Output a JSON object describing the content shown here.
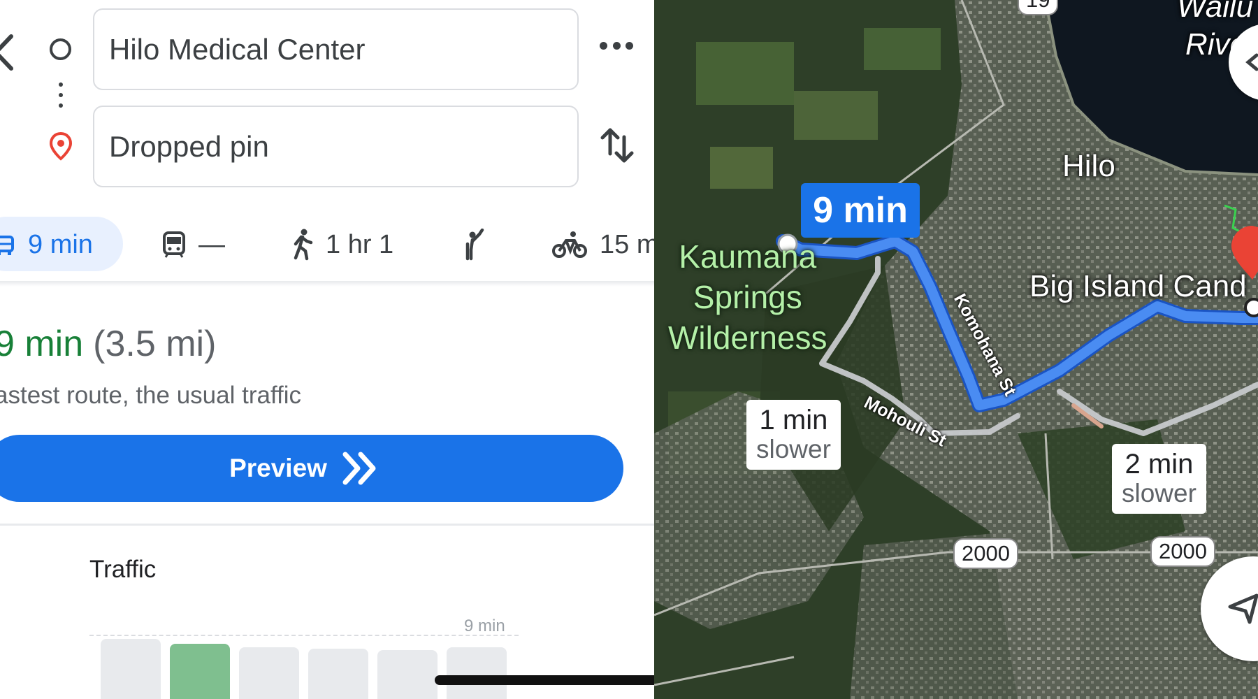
{
  "search": {
    "origin": "Hilo Medical Center",
    "destination": "Dropped pin"
  },
  "modes": {
    "drive": "9 min",
    "transit": "—",
    "walk": "1 hr 1",
    "hail": "",
    "bike": "15 m"
  },
  "route": {
    "time": "9 min",
    "distance": "(3.5 mi)",
    "description": "astest route, the usual traffic"
  },
  "preview_label": "Preview",
  "traffic": {
    "title": "Traffic",
    "axis_label": "9 min",
    "bars": [
      0.72,
      0.66,
      0.62,
      0.6,
      0.58,
      0.62
    ]
  },
  "map": {
    "route_time": "9 min",
    "city_label": "Hilo",
    "place_label": "Big Island Cand",
    "park_label_line1": "Kaumana",
    "park_label_line2": "Springs",
    "park_label_line3": "Wilderness",
    "river_label_line1": "Wailu",
    "river_label_line2": "Rive",
    "streets": {
      "komohana": "Komohana St",
      "mohouli": "Mohouli St"
    },
    "alt_routes": [
      {
        "time": "1 min",
        "note": "slower"
      },
      {
        "time": "2 min",
        "note": "slower"
      }
    ],
    "shields": [
      "2000",
      "2000",
      "19"
    ]
  },
  "colors": {
    "accent": "#1a73e8",
    "eta_green": "#188038",
    "traffic_bar_highlight": "#7fbf8f",
    "pin_red": "#ea4335"
  },
  "icons": [
    "back-chevron-icon",
    "origin-circle-icon",
    "destination-pin-icon",
    "more-icon",
    "swap-icon",
    "car-icon",
    "transit-icon",
    "walk-icon",
    "hail-icon",
    "bike-icon",
    "double-chevron-right-icon",
    "compass-icon",
    "navigate-icon"
  ]
}
